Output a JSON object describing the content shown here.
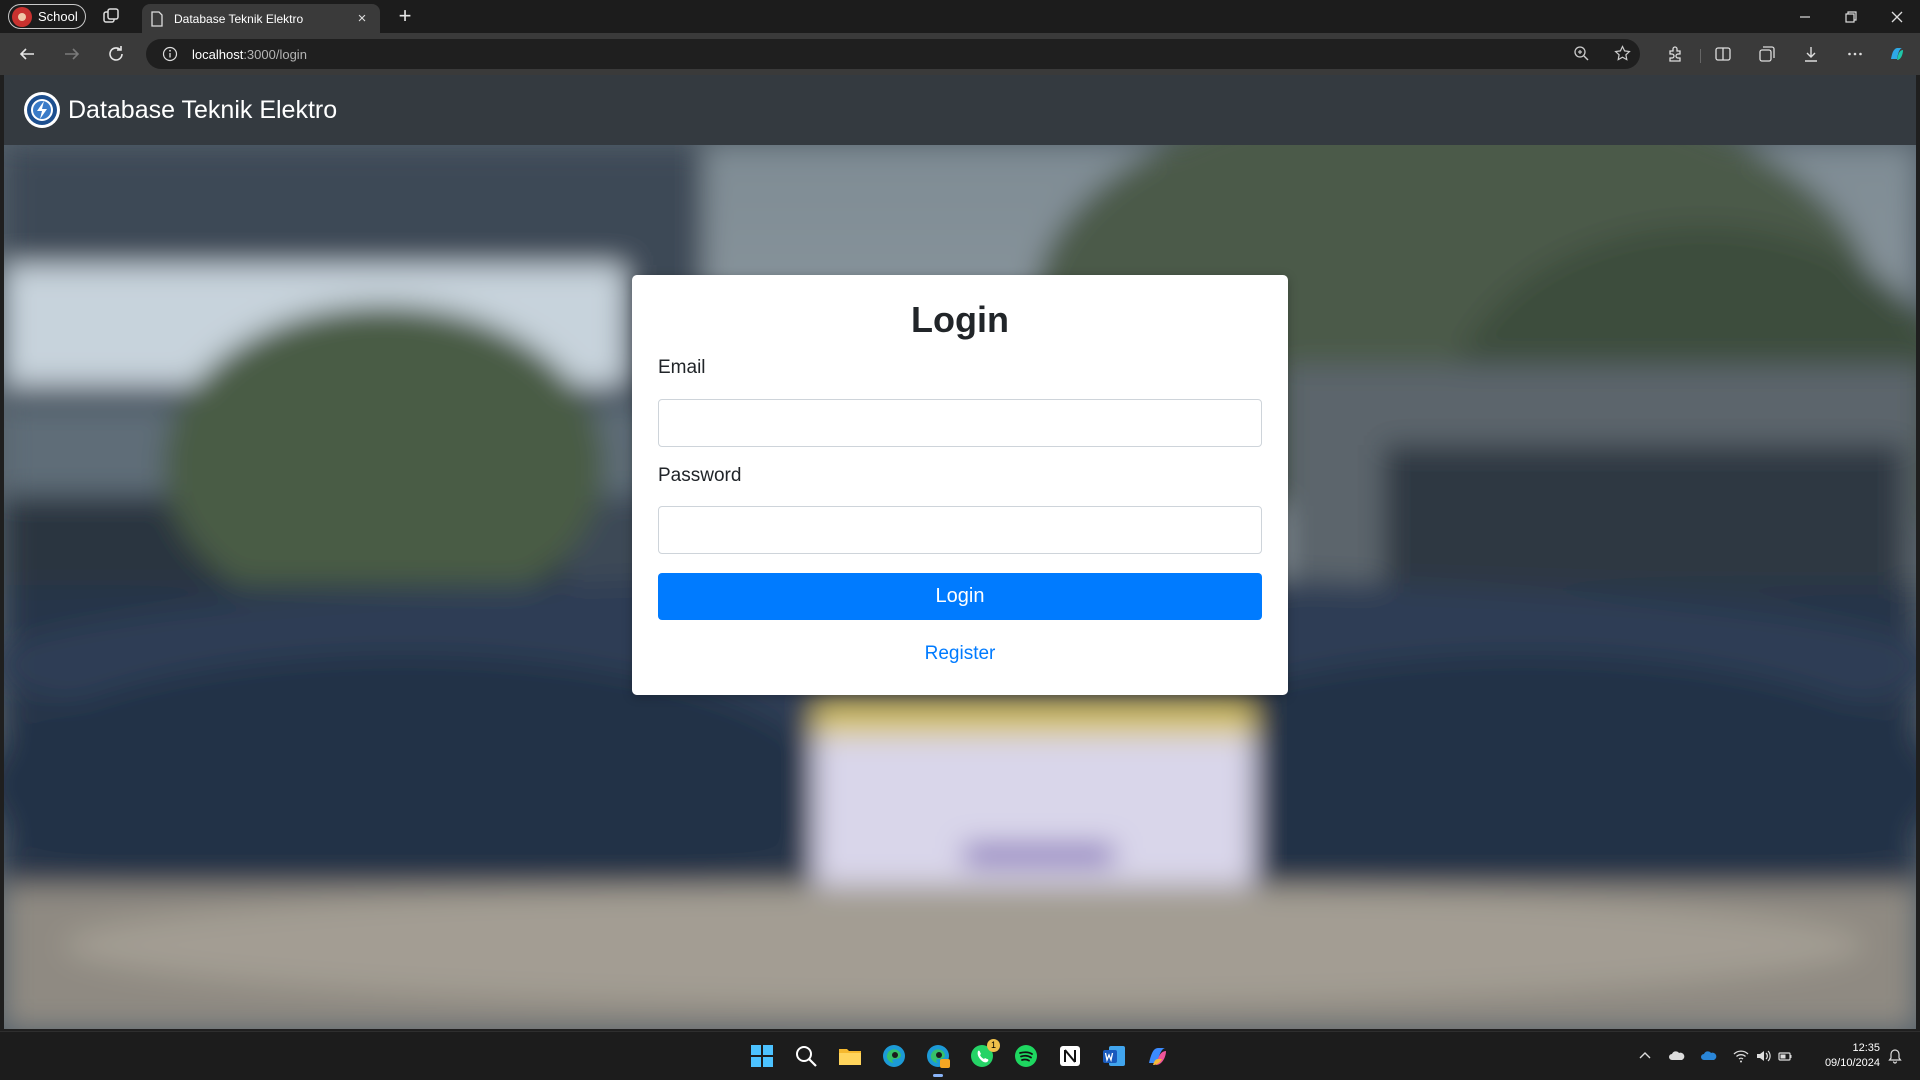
{
  "browser": {
    "profile_label": "School",
    "tab_title": "Database Teknik Elektro",
    "url_host": "localhost",
    "url_path": ":3000/login"
  },
  "navbar": {
    "brand": "Database Teknik Elektro"
  },
  "login": {
    "heading": "Login",
    "email_label": "Email",
    "email_value": "",
    "password_label": "Password",
    "password_value": "",
    "submit_label": "Login",
    "register_link": "Register"
  },
  "taskbar": {
    "whatsapp_badge": "1",
    "time": "12:35",
    "date": "09/10/2024"
  },
  "colors": {
    "navbar_bg": "#343a40",
    "primary": "#007bff",
    "browser_bg": "#3a3a3a"
  }
}
